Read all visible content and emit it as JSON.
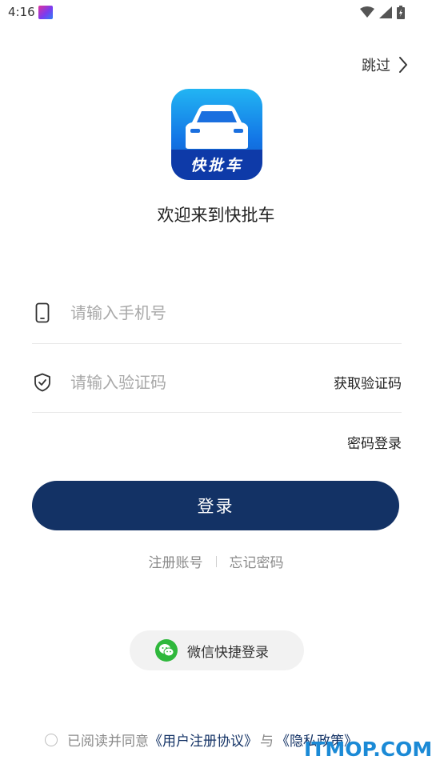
{
  "status_bar": {
    "time": "4:16"
  },
  "header": {
    "skip_label": "跳过"
  },
  "logo": {
    "text": "快批车"
  },
  "welcome": "欢迎来到快批车",
  "form": {
    "phone_placeholder": "请输入手机号",
    "code_placeholder": "请输入验证码",
    "get_code_label": "获取验证码",
    "password_login_label": "密码登录",
    "login_label": "登录"
  },
  "links": {
    "register": "注册账号",
    "forgot_password": "忘记密码"
  },
  "wechat": {
    "label": "微信快捷登录"
  },
  "agreement": {
    "prefix": "已阅读并同意",
    "user_agreement": "《用户注册协议》",
    "and": "与",
    "privacy_policy": "《隐私政策》"
  },
  "watermark": "ITMOP.COM",
  "colors": {
    "primary": "#133265",
    "wechat_green": "#2fb83c",
    "placeholder": "#a8a8a8"
  },
  "icons": [
    "app-notification-icon",
    "wifi-icon",
    "signal-icon",
    "battery-icon",
    "chevron-right-icon",
    "phone-icon",
    "shield-check-icon",
    "wechat-icon"
  ]
}
